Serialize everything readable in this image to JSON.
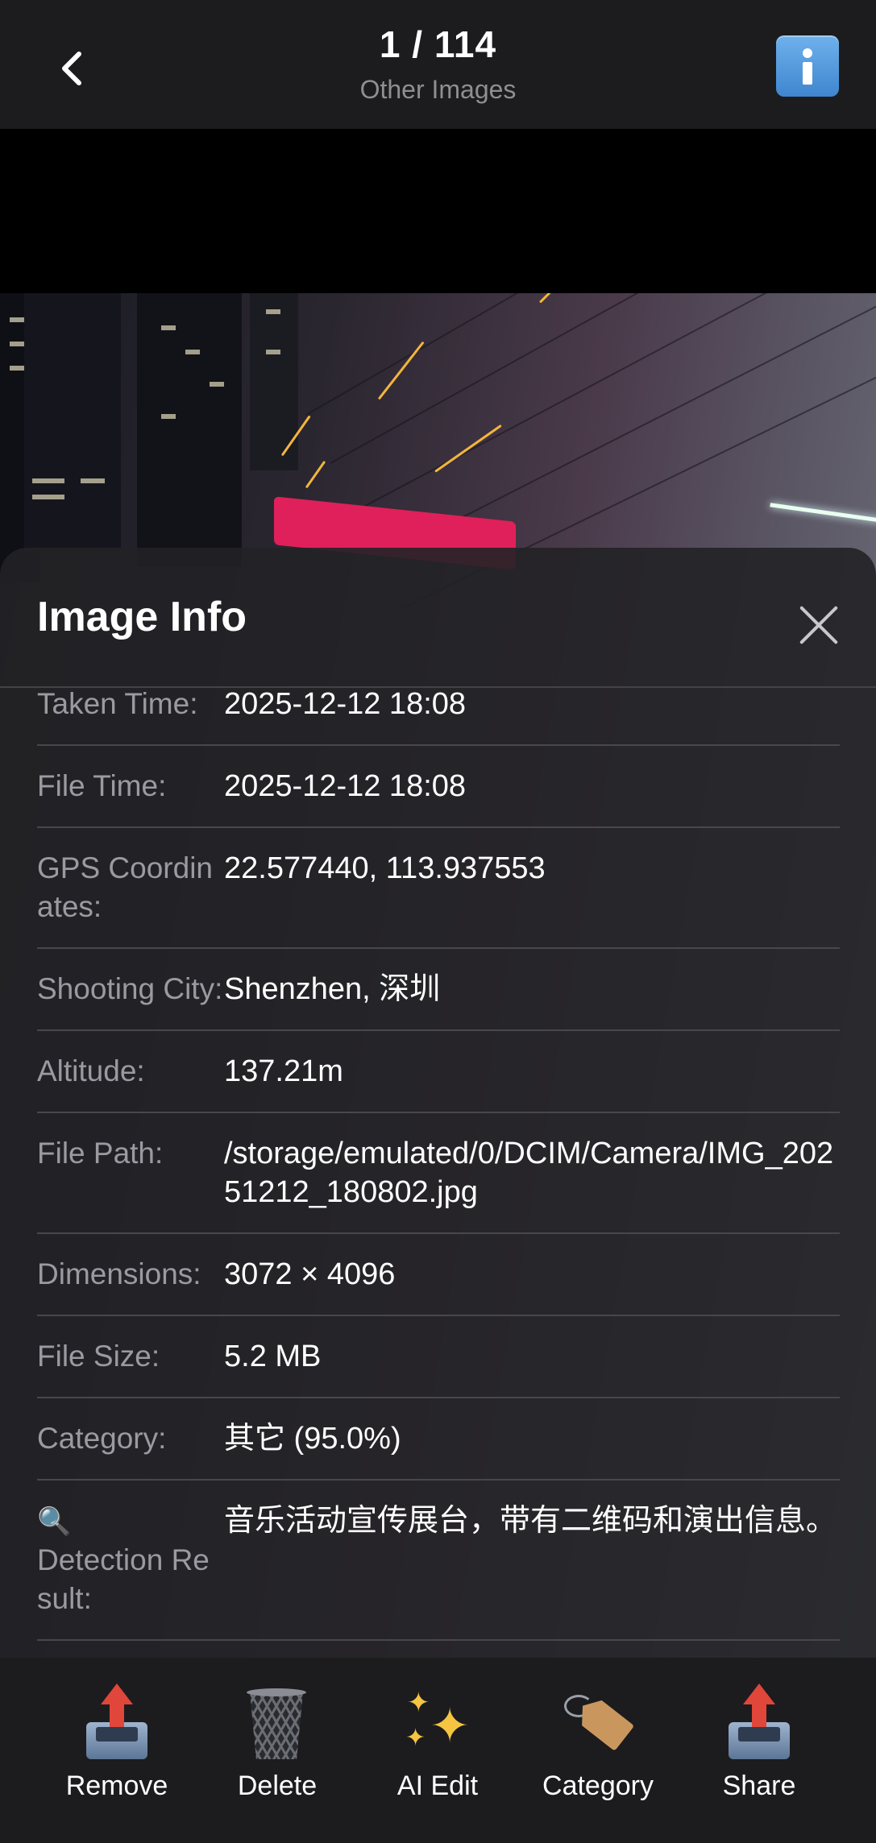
{
  "header": {
    "counter": "1 / 114",
    "album": "Other Images"
  },
  "sheet": {
    "title": "Image Info",
    "rows": [
      {
        "label": "Taken Time:",
        "value": "2025-12-12 18:08"
      },
      {
        "label": "File Time:",
        "value": "2025-12-12 18:08"
      },
      {
        "label": "GPS Coordinates:",
        "value": "22.577440, 113.937553"
      },
      {
        "label": "Shooting City:",
        "value": "Shenzhen, 深圳"
      },
      {
        "label": "Altitude:",
        "value": "137.21m"
      },
      {
        "label": "File Path:",
        "value": "/storage/emulated/0/DCIM/Camera/IMG_20251212_180802.jpg"
      },
      {
        "label": "Dimensions:",
        "value": "3072 × 4096"
      },
      {
        "label": "File Size:",
        "value": "5.2 MB"
      },
      {
        "label": "Category:",
        "value": "其它 (95.0%)"
      },
      {
        "label_icon": "🔍",
        "label": "Detection Result:",
        "value": "音乐活动宣传展台，带有二维码和演出信息。"
      }
    ]
  },
  "toolbar": {
    "items": [
      {
        "label": "Remove",
        "icon": "outbox-tray-icon"
      },
      {
        "label": "Delete",
        "icon": "wastebasket-icon"
      },
      {
        "label": "AI Edit",
        "icon": "sparkles-icon"
      },
      {
        "label": "Category",
        "icon": "label-tag-icon"
      },
      {
        "label": "Share",
        "icon": "outbox-tray-icon"
      }
    ]
  },
  "colors": {
    "accent": "#4a90d9",
    "sheet_bg": "#222226",
    "bar_bg": "#1c1c1e"
  }
}
